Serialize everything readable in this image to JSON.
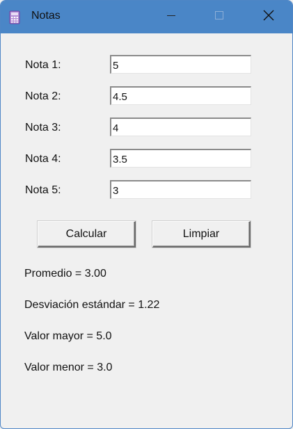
{
  "window": {
    "title": "Notas",
    "title_bar_color": "#4a86c7",
    "icons": [
      "calculator-app-icon",
      "minimize-icon",
      "maximize-icon",
      "close-icon"
    ]
  },
  "form": {
    "fields": [
      {
        "label": "Nota 1:",
        "value": "5"
      },
      {
        "label": "Nota 2:",
        "value": "4.5"
      },
      {
        "label": "Nota 3:",
        "value": "4"
      },
      {
        "label": "Nota 4:",
        "value": "3.5"
      },
      {
        "label": "Nota 5:",
        "value": "3"
      }
    ]
  },
  "buttons": {
    "calculate_label": "Calcular",
    "clear_label": "Limpiar"
  },
  "results": {
    "average": "Promedio = 3.00",
    "std_dev": "Desviación estándar = 1.22",
    "max": "Valor mayor = 5.0",
    "min": "Valor menor = 3.0"
  }
}
